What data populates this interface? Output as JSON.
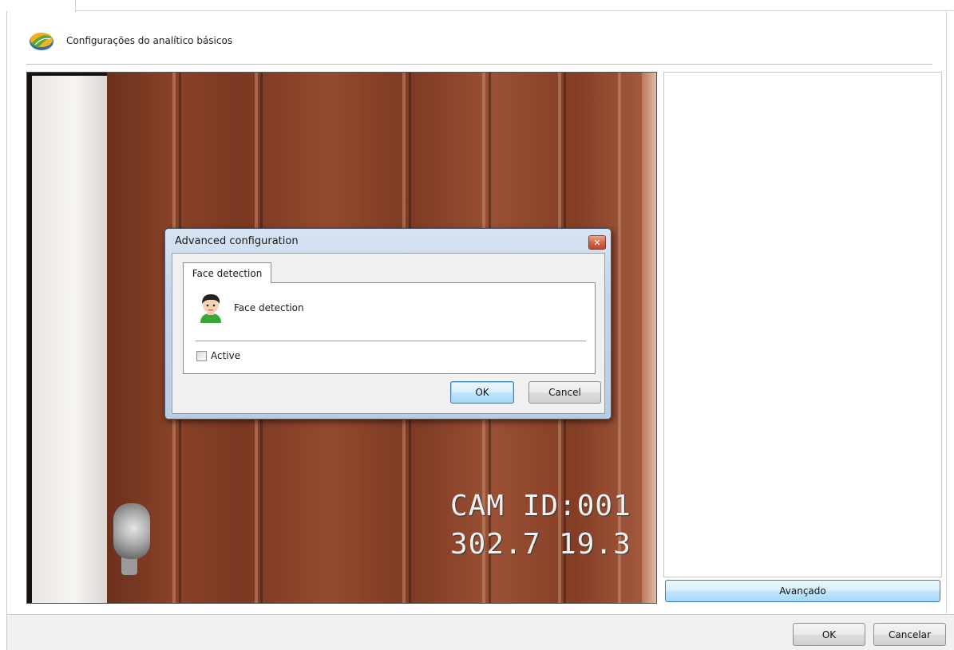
{
  "header": {
    "title": "Configurações do analítico básicos"
  },
  "camera": {
    "osd_line1": "CAM ID:001",
    "osd_line2": "302.7 19.3"
  },
  "right_panel": {
    "advanced_button": "Avançado"
  },
  "footer": {
    "ok_label": "OK",
    "cancel_label": "Cancelar"
  },
  "dialog": {
    "title": "Advanced configuration",
    "close_glyph": "✕",
    "tab_label": "Face detection",
    "item_label": "Face detection",
    "checkbox_label": "Active",
    "checkbox_checked": false,
    "ok_label": "OK",
    "cancel_label": "Cancel"
  },
  "colors": {
    "accent_blue": "#3c7fb1",
    "dialog_frame": "#c4d5e8",
    "close_red": "#d4664a"
  },
  "icons": {
    "header_logo": "analytics-logo-icon",
    "face": "face-detection-icon",
    "close": "close-icon"
  }
}
